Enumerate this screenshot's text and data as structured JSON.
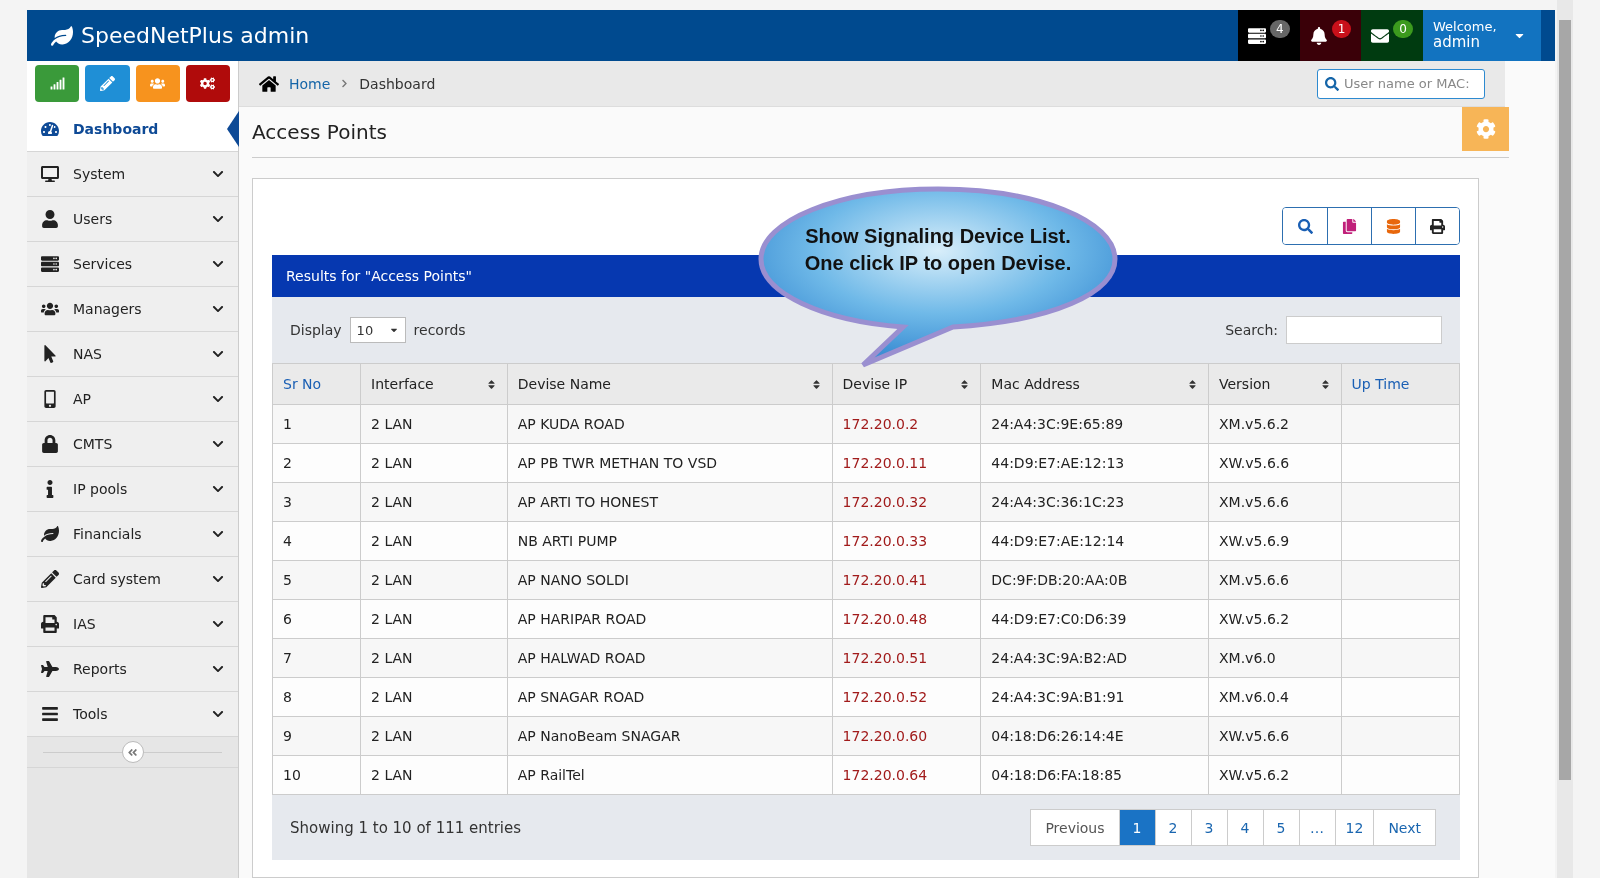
{
  "header": {
    "brand": "SpeedNetPlus admin",
    "badges": [
      {
        "kind": "tasks",
        "count": "4"
      },
      {
        "kind": "alerts",
        "count": "1"
      },
      {
        "kind": "messages",
        "count": "0"
      }
    ],
    "user": {
      "greeting": "Welcome,",
      "name": "admin"
    }
  },
  "quick_buttons": [
    {
      "kind": "stats"
    },
    {
      "kind": "edit"
    },
    {
      "kind": "users"
    },
    {
      "kind": "settings"
    }
  ],
  "breadcrumb": [
    "Home",
    "Dashboard"
  ],
  "search": {
    "placeholder": "User name or MAC:"
  },
  "sidebar": {
    "items": [
      {
        "label": "Dashboard",
        "selected": true,
        "expandable": false
      },
      {
        "label": "System",
        "selected": false,
        "expandable": true
      },
      {
        "label": "Users",
        "selected": false,
        "expandable": true
      },
      {
        "label": "Services",
        "selected": false,
        "expandable": true
      },
      {
        "label": "Managers",
        "selected": false,
        "expandable": true
      },
      {
        "label": "NAS",
        "selected": false,
        "expandable": true
      },
      {
        "label": "AP",
        "selected": false,
        "expandable": true
      },
      {
        "label": "CMTS",
        "selected": false,
        "expandable": true
      },
      {
        "label": "IP pools",
        "selected": false,
        "expandable": true
      },
      {
        "label": "Financials",
        "selected": false,
        "expandable": true
      },
      {
        "label": "Card system",
        "selected": false,
        "expandable": true
      },
      {
        "label": "IAS",
        "selected": false,
        "expandable": true
      },
      {
        "label": "Reports",
        "selected": false,
        "expandable": true
      },
      {
        "label": "Tools",
        "selected": false,
        "expandable": true
      }
    ]
  },
  "page_title": "Access Points",
  "callout": [
    "Show Signaling Device List.",
    "One click IP to open Devise."
  ],
  "results_title": "Results for \"Access Points\"",
  "length": {
    "before": "Display",
    "value": "10",
    "after": "records"
  },
  "filter": {
    "label": "Search:"
  },
  "table": {
    "columns": [
      {
        "label": "Sr No",
        "sortable": false
      },
      {
        "label": "Interface",
        "sortable": true
      },
      {
        "label": "Devise Name",
        "sortable": true
      },
      {
        "label": "Devise IP",
        "sortable": true
      },
      {
        "label": "Mac Address",
        "sortable": true
      },
      {
        "label": "Version",
        "sortable": true
      },
      {
        "label": "Up Time",
        "sortable": false
      }
    ],
    "rows": [
      [
        "1",
        "2 LAN",
        "AP KUDA ROAD",
        "172.20.0.2",
        "24:A4:3C:9E:65:89",
        "XM.v5.6.2"
      ],
      [
        "2",
        "2 LAN",
        "AP PB TWR METHAN TO VSD",
        "172.20.0.11",
        "44:D9:E7:AE:12:13",
        "XW.v5.6.6"
      ],
      [
        "3",
        "2 LAN",
        "AP ARTI TO HONEST",
        "172.20.0.32",
        "24:A4:3C:36:1C:23",
        "XM.v5.6.6"
      ],
      [
        "4",
        "2 LAN",
        "NB ARTI PUMP",
        "172.20.0.33",
        "44:D9:E7:AE:12:14",
        "XW.v5.6.9"
      ],
      [
        "5",
        "2 LAN",
        "AP NANO SOLDI",
        "172.20.0.41",
        "DC:9F:DB:20:AA:0B",
        "XM.v5.6.6"
      ],
      [
        "6",
        "2 LAN",
        "AP HARIPAR ROAD",
        "172.20.0.48",
        "44:D9:E7:C0:D6:39",
        "XW.v5.6.2"
      ],
      [
        "7",
        "2 LAN",
        "AP HALWAD ROAD",
        "172.20.0.51",
        "24:A4:3C:9A:B2:AD",
        "XM.v6.0"
      ],
      [
        "8",
        "2 LAN",
        "AP SNAGAR ROAD",
        "172.20.0.52",
        "24:A4:3C:9A:B1:91",
        "XM.v6.0.4"
      ],
      [
        "9",
        "2 LAN",
        "AP NanoBeam SNAGAR",
        "172.20.0.60",
        "04:18:D6:26:14:4E",
        "XW.v5.6.6"
      ],
      [
        "10",
        "2 LAN",
        "AP RailTel",
        "172.20.0.64",
        "04:18:D6:FA:18:85",
        "XW.v5.6.2"
      ]
    ]
  },
  "info": "Showing 1 to 10 of 111 entries",
  "pagination": [
    {
      "label": "Previous",
      "selected": false
    },
    {
      "label": "1",
      "selected": true
    },
    {
      "label": "2",
      "selected": false
    },
    {
      "label": "3",
      "selected": false
    },
    {
      "label": "4",
      "selected": false
    },
    {
      "label": "5",
      "selected": false
    },
    {
      "label": "…",
      "selected": false
    },
    {
      "label": "12",
      "selected": false
    },
    {
      "label": "Next",
      "selected": false
    }
  ]
}
